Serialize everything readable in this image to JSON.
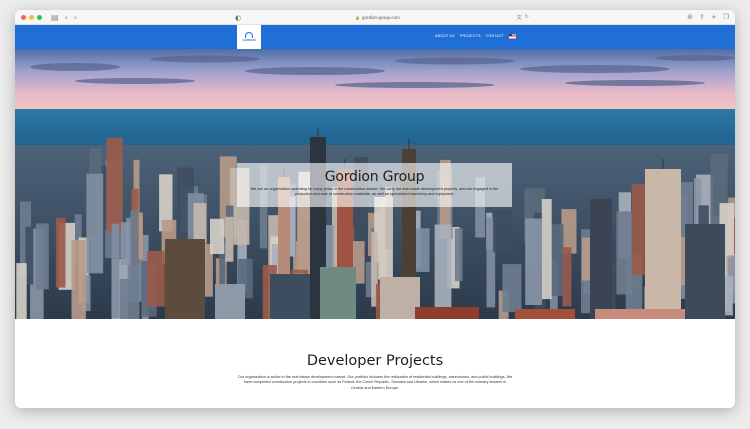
{
  "browser": {
    "url": "gordion-group.com",
    "tab_icons": [
      "sidebar-icon",
      "chevron-down-icon",
      "back-icon",
      "forward-icon"
    ],
    "right_icons": [
      "download-icon",
      "share-icon",
      "new-tab-icon",
      "tabs-icon"
    ]
  },
  "navbar": {
    "logo_text": "GORDION",
    "links": [
      "ABOUT US",
      "PROJECTS",
      "CONTACT"
    ],
    "language": "us-flag",
    "brand_color": "#1f6fd6"
  },
  "hero": {
    "title": "Gordion Group",
    "text": "We are an organization operating for many years in the construction market. We carry out real estate development projects, and are engaged in the production and sale of construction materials, as well as specialized machinery and equipment."
  },
  "projects": {
    "title": "Developer Projects",
    "text": "Our organization is active in the real estate development market. Our portfolio includes the realization of residential buildings, warehouses, and public buildings. We have completed construction projects in countries such as Poland, the Czech Republic, Slovakia and Ukraine, which makes us one of the industry leaders in Central and Eastern Europe."
  }
}
